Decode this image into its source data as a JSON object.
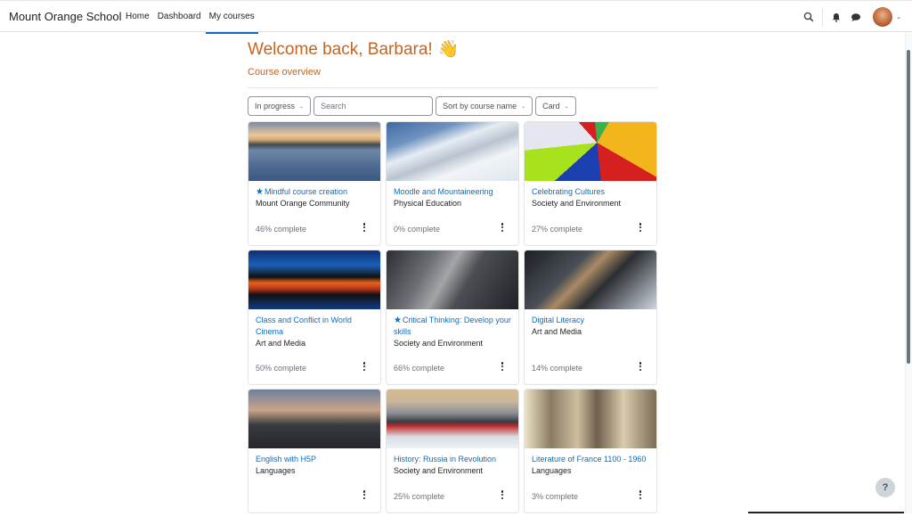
{
  "header": {
    "brand": "Mount Orange School",
    "nav": [
      {
        "label": "Home",
        "active": false
      },
      {
        "label": "Dashboard",
        "active": false
      },
      {
        "label": "My courses",
        "active": true
      }
    ],
    "icons": [
      "search-icon",
      "bell-icon",
      "chat-icon",
      "avatar",
      "chevron-down-icon"
    ]
  },
  "page": {
    "welcome": "Welcome back, Barbara!",
    "wave_emoji": "👋",
    "section_title": "Course overview"
  },
  "filters": {
    "status": "In progress",
    "search_placeholder": "Search",
    "sort": "Sort by course name",
    "view": "Card"
  },
  "courses": [
    {
      "name": "Mindful course creation",
      "category": "Mount Orange Community",
      "progress": "46% complete",
      "starred": true,
      "image": "lake-swans"
    },
    {
      "name": "Moodle and Mountaineering",
      "category": "Physical Education",
      "progress": "0% complete",
      "starred": false,
      "image": "snowy-mountain"
    },
    {
      "name": "Celebrating Cultures",
      "category": "Society and Environment",
      "progress": "27% complete",
      "starred": false,
      "image": "umbrellas"
    },
    {
      "name": "Class and Conflict in World Cinema",
      "category": "Art and Media",
      "progress": "50% complete",
      "starred": false,
      "image": "film-strip"
    },
    {
      "name": "Critical Thinking: Develop your skills",
      "category": "Society and Environment",
      "progress": "66% complete",
      "starred": true,
      "image": "thinker-statue"
    },
    {
      "name": "Digital Literacy",
      "category": "Art and Media",
      "progress": "14% complete",
      "starred": false,
      "image": "laptop-bookshelf"
    },
    {
      "name": "English with H5P",
      "category": "Languages",
      "progress": "",
      "starred": false,
      "image": "westminster"
    },
    {
      "name": "History: Russia in Revolution",
      "category": "Society and Environment",
      "progress": "25% complete",
      "starred": false,
      "image": "horse-carriages"
    },
    {
      "name": "Literature of France 1100 - 1960",
      "category": "Languages",
      "progress": "3% complete",
      "starred": false,
      "image": "french-writers"
    }
  ],
  "help": "?"
}
